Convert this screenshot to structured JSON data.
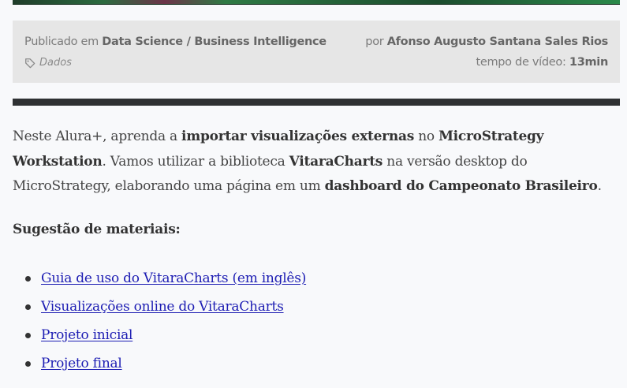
{
  "meta": {
    "published_prefix": "Publicado em",
    "category": "Data Science / Business Intelligence",
    "tag": "Dados",
    "author_prefix": "por",
    "author": "Afonso Augusto Santana Sales Rios",
    "duration_prefix": "tempo de vídeo:",
    "duration": "13min"
  },
  "intro": {
    "p1": "Neste Alura+, aprenda a ",
    "b1": "importar visualizações externas",
    "p2": " no ",
    "b2": "MicroStrategy Workstation",
    "p3": ". Vamos utilizar a biblioteca ",
    "b3": "VitaraCharts",
    "p4": " na versão desktop do MicroStrategy, elaborando uma página em um ",
    "b4": "dashboard do Campeonato Brasileiro",
    "p5": "."
  },
  "materials": {
    "heading": "Sugestão de materiais:",
    "links": [
      {
        "label": "Guia de uso do VitaraCharts (em inglês)"
      },
      {
        "label": "Visualizações online do VitaraCharts"
      },
      {
        "label": "Projeto inicial"
      },
      {
        "label": "Projeto final"
      }
    ]
  },
  "icons": {
    "tag": "tag-icon"
  },
  "colors": {
    "link": "#1d1db3",
    "meta_background": "#e6e6e6",
    "divider": "#2f3133"
  }
}
